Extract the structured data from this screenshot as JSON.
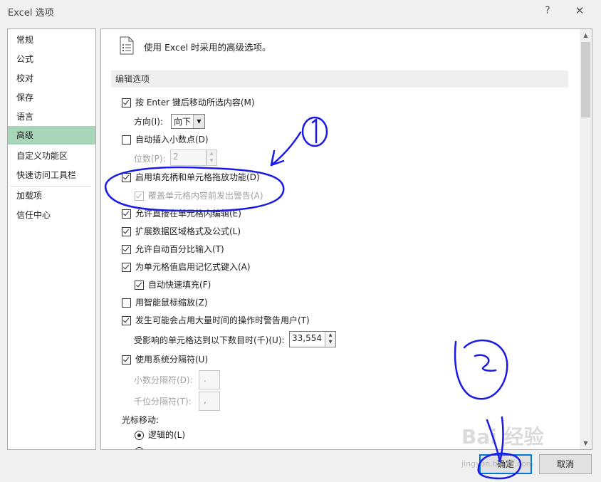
{
  "window": {
    "title": "Excel 选项",
    "help": "?",
    "close": "✕"
  },
  "nav": [
    {
      "label": "常规"
    },
    {
      "label": "公式"
    },
    {
      "label": "校对"
    },
    {
      "label": "保存"
    },
    {
      "label": "语言"
    },
    {
      "label": "高级",
      "selected": true
    },
    {
      "label": "自定义功能区"
    },
    {
      "label": "快速访问工具栏"
    },
    {
      "label": "加载项"
    },
    {
      "label": "信任中心"
    }
  ],
  "header": {
    "text": "使用 Excel 时采用的高级选项。"
  },
  "section": {
    "title": "编辑选项"
  },
  "options": {
    "move_after_enter": {
      "label": "按 Enter 键后移动所选内容(M)",
      "checked": true
    },
    "direction_label": "方向(I):",
    "direction_value": "向下",
    "auto_decimal": {
      "label": "自动插入小数点(D)",
      "checked": false
    },
    "places_label": "位数(P):",
    "places_value": "2",
    "fill_handle": {
      "label": "启用填充柄和单元格拖放功能(D)",
      "checked": true
    },
    "overwrite_alert": {
      "label": "覆盖单元格内容前发出警告(A)",
      "checked": true
    },
    "edit_in_cell": {
      "label": "允许直接在单元格内编辑(E)",
      "checked": true
    },
    "extend_formats": {
      "label": "扩展数据区域格式及公式(L)",
      "checked": true
    },
    "auto_percent": {
      "label": "允许自动百分比输入(T)",
      "checked": true
    },
    "autocomplete": {
      "label": "为单元格值启用记忆式键入(A)",
      "checked": true
    },
    "flash_fill": {
      "label": "自动快速填充(F)",
      "checked": true
    },
    "zoom_intellimouse": {
      "label": "用智能鼠标缩放(Z)",
      "checked": false
    },
    "alert_long_ops": {
      "label": "发生可能会占用大量时间的操作时警告用户(T)",
      "checked": true
    },
    "cells_affected_label": "受影响的单元格达到以下数目时(千)(U):",
    "cells_affected_value": "33,554",
    "system_separators": {
      "label": "使用系统分隔符(U)",
      "checked": true
    },
    "decimal_sep_label": "小数分隔符(D):",
    "decimal_sep_value": ".",
    "thousands_sep_label": "千位分隔符(T):",
    "thousands_sep_value": ",",
    "cursor_movement_label": "光标移动:",
    "logical": {
      "label": "逻辑的(L)",
      "selected": true
    }
  },
  "buttons": {
    "ok": "确定",
    "cancel": "取消"
  },
  "annotations": {
    "mark1": "①",
    "mark2": "②"
  },
  "watermark": {
    "brand": "Bai 经验",
    "url": "jingyan.baidu.com"
  }
}
